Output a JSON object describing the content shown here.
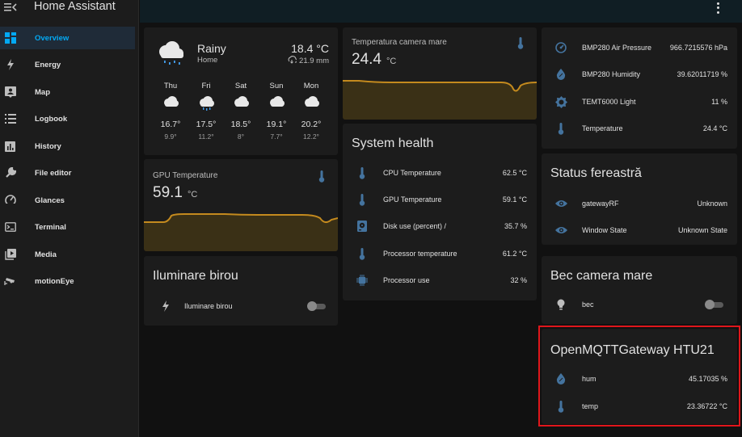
{
  "app": {
    "title": "Home Assistant"
  },
  "sidebar": {
    "items": [
      {
        "label": "Overview",
        "icon": "grid-icon"
      },
      {
        "label": "Energy",
        "icon": "lightning-icon"
      },
      {
        "label": "Map",
        "icon": "map-person-icon"
      },
      {
        "label": "Logbook",
        "icon": "list-icon"
      },
      {
        "label": "History",
        "icon": "chart-box-icon"
      },
      {
        "label": "File editor",
        "icon": "wrench-icon"
      },
      {
        "label": "Glances",
        "icon": "gauge-icon"
      },
      {
        "label": "Terminal",
        "icon": "console-icon"
      },
      {
        "label": "Media",
        "icon": "play-box-icon"
      },
      {
        "label": "motionEye",
        "icon": "cctv-icon"
      }
    ]
  },
  "weather": {
    "condition": "Rainy",
    "location": "Home",
    "temperature": "18.4 °C",
    "precipitation": "21.9 mm",
    "forecast": [
      {
        "day": "Thu",
        "high": "16.7°",
        "low": "9.9°",
        "icon": "cloudy-icon"
      },
      {
        "day": "Fri",
        "high": "17.5°",
        "low": "11.2°",
        "icon": "rainy-icon"
      },
      {
        "day": "Sat",
        "high": "18.5°",
        "low": "8°",
        "icon": "cloudy-icon"
      },
      {
        "day": "Sun",
        "high": "19.1°",
        "low": "7.7°",
        "icon": "cloudy-icon"
      },
      {
        "day": "Mon",
        "high": "20.2°",
        "low": "12.2°",
        "icon": "cloudy-icon"
      }
    ]
  },
  "gpu_card": {
    "title": "GPU Temperature",
    "value": "59.1",
    "unit": "°C"
  },
  "iluminare": {
    "title": "Iluminare birou",
    "entity": "Iluminare birou",
    "state": "off"
  },
  "temp_camera": {
    "title": "Temperatura camera mare",
    "value": "24.4",
    "unit": "°C"
  },
  "system_health": {
    "title": "System health",
    "rows": [
      {
        "label": "CPU Temperature",
        "value": "62.5 °C",
        "icon": "thermometer-icon"
      },
      {
        "label": "GPU Temperature",
        "value": "59.1 °C",
        "icon": "thermometer-icon"
      },
      {
        "label": "Disk use (percent) /",
        "value": "35.7 %",
        "icon": "harddisk-icon"
      },
      {
        "label": "Processor temperature",
        "value": "61.2 °C",
        "icon": "thermometer-icon"
      },
      {
        "label": "Processor use",
        "value": "32 %",
        "icon": "cpu-icon"
      }
    ]
  },
  "sensors": {
    "rows": [
      {
        "label": "BMP280 Air Pressure",
        "value": "966.7215576 hPa",
        "icon": "gauge-icon"
      },
      {
        "label": "BMP280 Humidity",
        "value": "39.62011719 %",
        "icon": "water-percent-icon"
      },
      {
        "label": "TEMT6000 Light",
        "value": "11 %",
        "icon": "brightness-icon"
      },
      {
        "label": "Temperature",
        "value": "24.4 °C",
        "icon": "thermometer-icon"
      }
    ]
  },
  "status_fereastra": {
    "title": "Status fereastră",
    "rows": [
      {
        "label": "gatewayRF",
        "value": "Unknown",
        "icon": "eye-icon"
      },
      {
        "label": "Window State",
        "value": "Unknown State",
        "icon": "eye-icon"
      }
    ]
  },
  "bec_camera": {
    "title": "Bec camera mare",
    "entity": "bec",
    "state": "off"
  },
  "htu21": {
    "title": "OpenMQTTGateway HTU21",
    "rows": [
      {
        "label": "hum",
        "value": "45.17035 %",
        "icon": "water-percent-icon"
      },
      {
        "label": "temp",
        "value": "23.36722 °C",
        "icon": "thermometer-icon"
      }
    ]
  },
  "colors": {
    "accent": "#03a9f4",
    "sparkline": "#c48a1e",
    "highlight": "#e0161b",
    "icon": "#44739e"
  }
}
